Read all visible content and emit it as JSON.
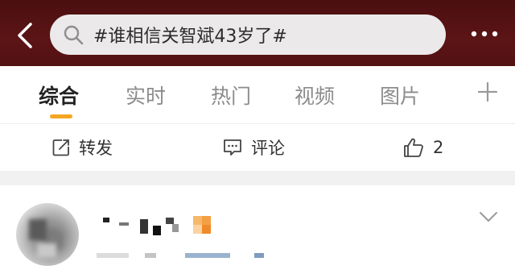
{
  "search": {
    "query": "#谁相信关智斌43岁了#"
  },
  "tabs": [
    {
      "label": "综合"
    },
    {
      "label": "实时"
    },
    {
      "label": "热门"
    },
    {
      "label": "视频"
    },
    {
      "label": "图片"
    }
  ],
  "actions": {
    "repost_label": "转发",
    "comment_label": "评论",
    "like_count": "2"
  },
  "icons": {
    "back": "chevron-left-icon",
    "search": "search-icon",
    "more": "more-icon",
    "add_tab": "plus-icon",
    "repost": "repost-icon",
    "comment": "comment-icon",
    "like": "thumbs-up-icon",
    "expand": "chevron-down-icon"
  },
  "colors": {
    "header_bg": "#521113",
    "active_tab_indicator": "#f5a623",
    "verified_badge": "#f5a623"
  }
}
